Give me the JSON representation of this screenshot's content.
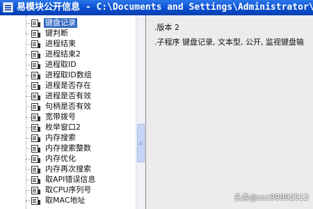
{
  "window": {
    "title": "易模块公开信息 - C:\\Documents and Settings\\Administrator\\桌"
  },
  "tree": {
    "items": [
      {
        "label": "键盘记录",
        "selected": true
      },
      {
        "label": "键判断"
      },
      {
        "label": "进程结束"
      },
      {
        "label": "进程结束2"
      },
      {
        "label": "进程取ID"
      },
      {
        "label": "进程取ID数组"
      },
      {
        "label": "进程是否存在"
      },
      {
        "label": "进程是否有效"
      },
      {
        "label": "句柄是否有效"
      },
      {
        "label": "宽带拨号"
      },
      {
        "label": "枚举窗口2"
      },
      {
        "label": "内存搜索"
      },
      {
        "label": "内存搜索整数"
      },
      {
        "label": "内存优化"
      },
      {
        "label": "内存再次搜索"
      },
      {
        "label": "取API错误信息"
      },
      {
        "label": "取CPU序列号"
      },
      {
        "label": "取MAC地址"
      }
    ]
  },
  "details": {
    "version": ".版本 2",
    "signature": ".子程序 键盘记录, 文本型, 公开, 监视键盘输"
  },
  "watermark": "头条@ccc99992512"
}
